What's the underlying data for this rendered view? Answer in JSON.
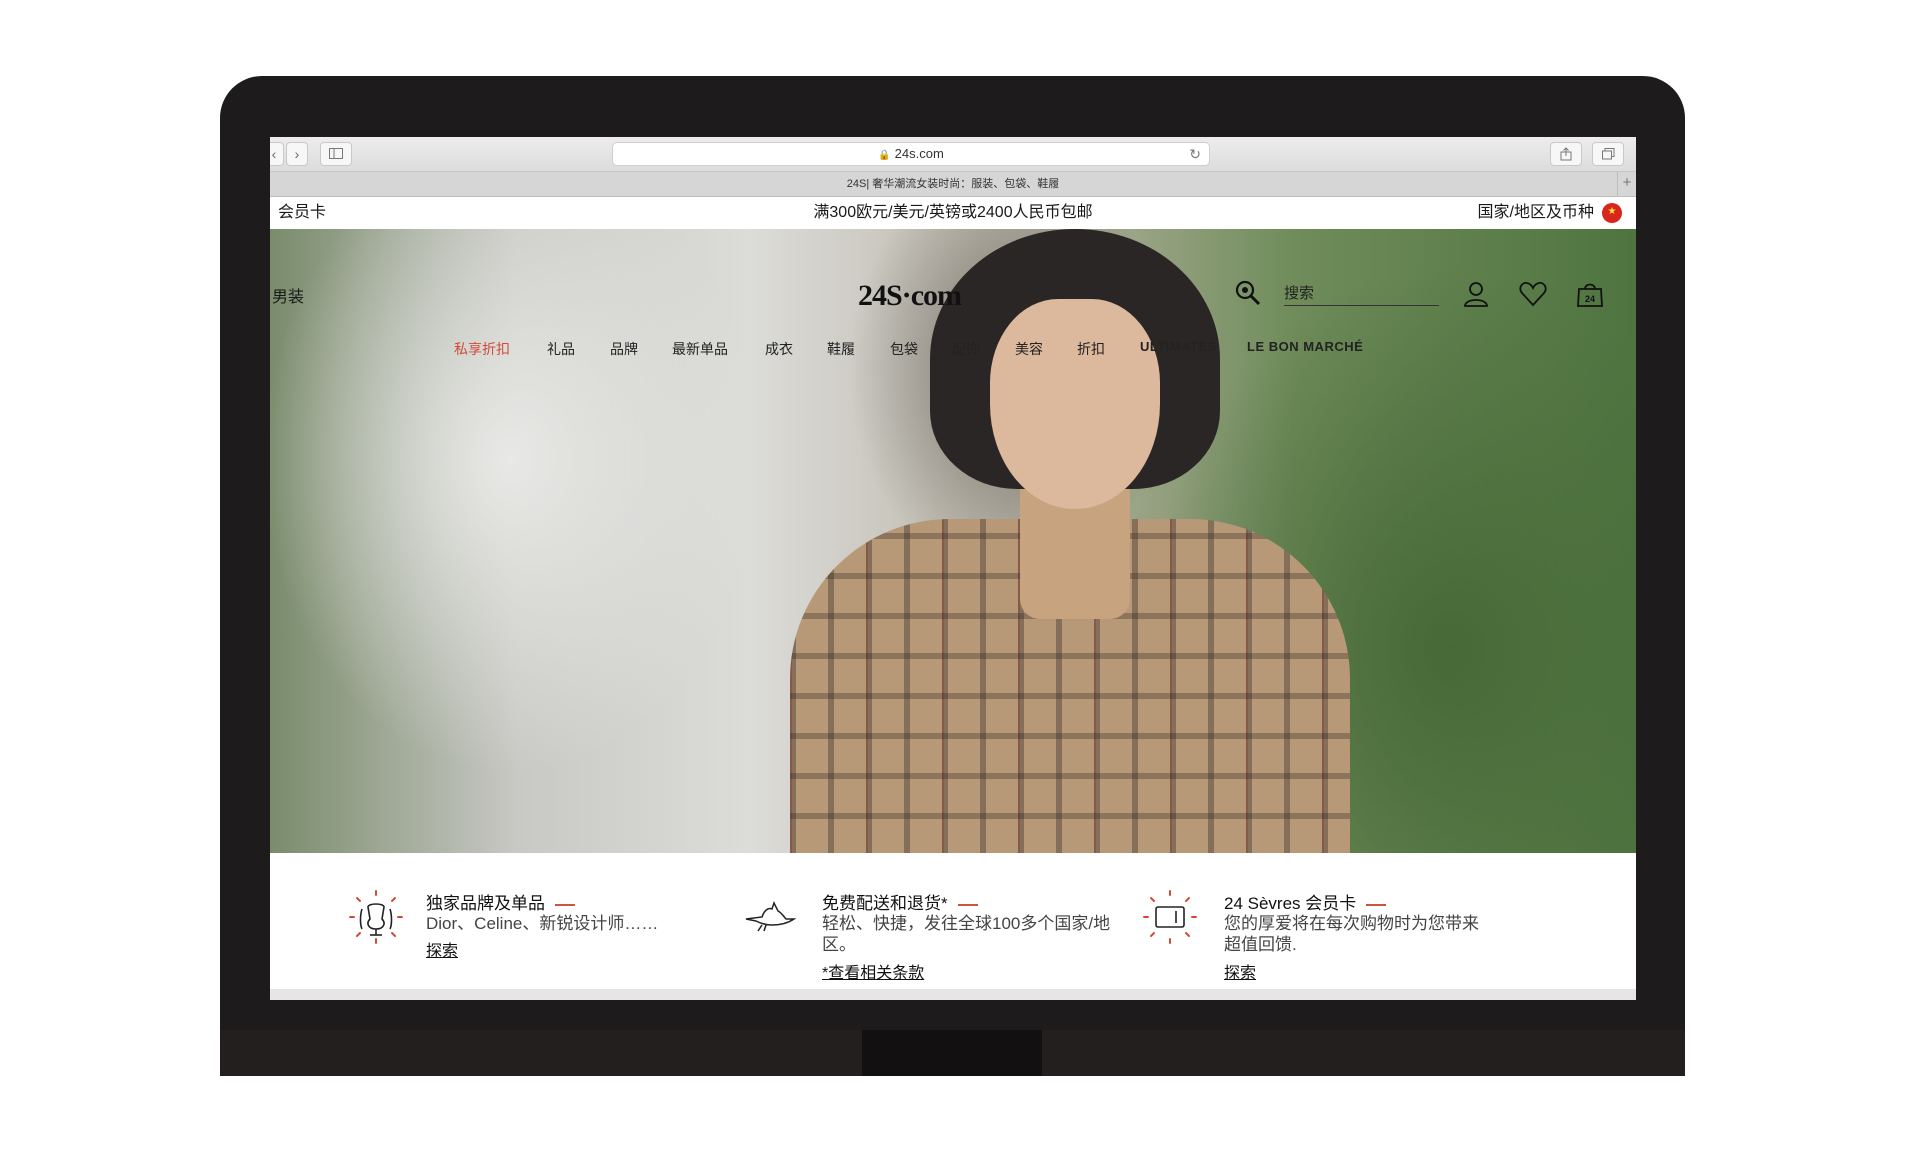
{
  "browser": {
    "url": "24s.com",
    "tab_title": "24S| 奢华潮流女装时尚：服装、包袋、鞋履",
    "back_icon": "chevron-left-icon",
    "forward_icon": "chevron-right-icon"
  },
  "promo": {
    "left": "会员卡",
    "center": "满300欧元/美元/英镑或2400人民币包邮",
    "right": "国家/地区及币种"
  },
  "header": {
    "gender": "男装",
    "logo": "24S·com",
    "search_placeholder": "搜索"
  },
  "menu": {
    "items": [
      {
        "label": "私享折扣"
      },
      {
        "label": "礼品"
      },
      {
        "label": "品牌"
      },
      {
        "label": "最新单品"
      },
      {
        "label": "成衣"
      },
      {
        "label": "鞋履"
      },
      {
        "label": "包袋"
      },
      {
        "label": "配饰"
      },
      {
        "label": "美容"
      },
      {
        "label": "折扣"
      },
      {
        "label": "ULTIMATES"
      },
      {
        "label": "LE BON MARCHÉ"
      }
    ]
  },
  "features": [
    {
      "title": "独家品牌及单品",
      "desc": "Dior、Celine、新锐设计师……",
      "link": "探索"
    },
    {
      "title": "免费配送和退货*",
      "desc": "轻松、快捷，发往全球100多个国家/地区。",
      "link": "*查看相关条款"
    },
    {
      "title": "24 Sèvres 会员卡",
      "desc": "您的厚爱将在每次购物时为您带来超值回馈.",
      "link": "探索"
    }
  ],
  "colors": {
    "accent_sale": "#d44a3a",
    "accent_dash": "#c8573c"
  }
}
